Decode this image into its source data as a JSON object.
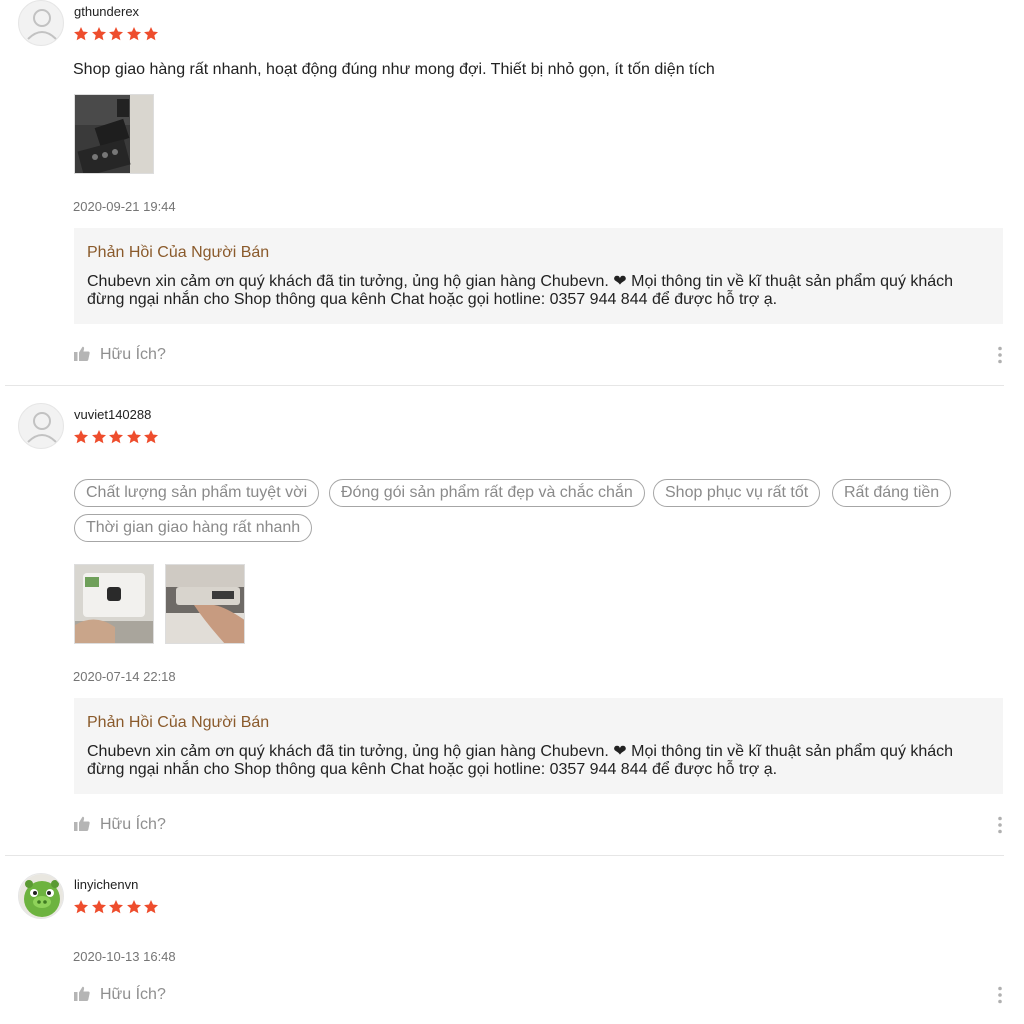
{
  "reviews": [
    {
      "username": "gthunderex",
      "rating": 5,
      "comment": "Shop giao hàng rất nhanh, hoạt động đúng như mong đợi. Thiết bị nhỏ gọn, ít tốn diện tích",
      "date": "2020-09-21 19:44",
      "reply_title": "Phản Hồi Của Người Bán",
      "reply_text": "Chubevn xin cảm ơn quý khách đã tin tưởng, ủng hộ gian hàng Chubevn. ❤ Mọi thông tin về kĩ thuật sản phẩm quý khách đừng ngại nhắn cho Shop thông qua kênh Chat hoặc gọi hotline: 0357 944 844 để được hỗ trợ ạ.",
      "helpful_label": "Hữu Ích?"
    },
    {
      "username": "vuviet140288",
      "rating": 5,
      "tags": [
        "Chất lượng sản phẩm tuyệt vời",
        "Đóng gói sản phẩm rất đẹp và chắc chắn",
        "Shop phục vụ rất tốt",
        "Rất đáng tiền",
        "Thời gian giao hàng rất nhanh"
      ],
      "date": "2020-07-14 22:18",
      "reply_title": "Phản Hồi Của Người Bán",
      "reply_text": "Chubevn xin cảm ơn quý khách đã tin tưởng, ủng hộ gian hàng Chubevn. ❤ Mọi thông tin về kĩ thuật sản phẩm quý khách đừng ngại nhắn cho Shop thông qua kênh Chat hoặc gọi hotline: 0357 944 844 để được hỗ trợ ạ.",
      "helpful_label": "Hữu Ích?"
    },
    {
      "username": "linyichenvn",
      "rating": 5,
      "date": "2020-10-13 16:48",
      "helpful_label": "Hữu Ích?"
    }
  ],
  "colors": {
    "star": "#ee4d2d",
    "reply_title": "#8a5a2b",
    "muted": "#8f8f8f"
  },
  "icons": [
    "default-avatar-icon",
    "pig-avatar-icon",
    "star-icon",
    "thumbs-up-icon",
    "more-vertical-icon"
  ]
}
